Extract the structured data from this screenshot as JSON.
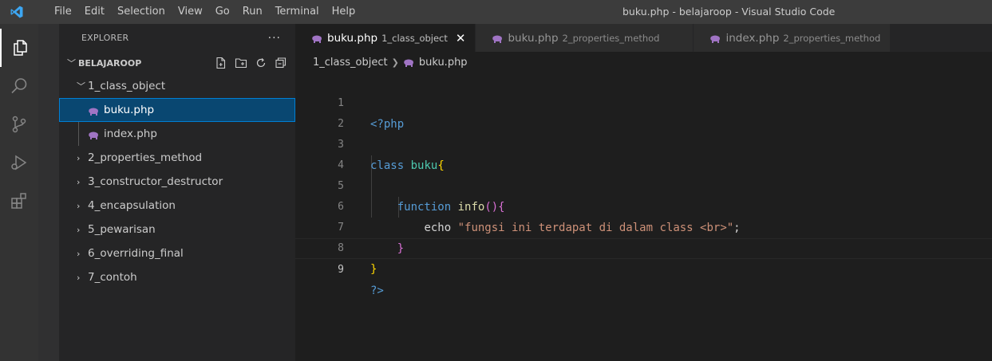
{
  "window": {
    "title": "buku.php - belajaroop - Visual Studio Code"
  },
  "menu": [
    "File",
    "Edit",
    "Selection",
    "View",
    "Go",
    "Run",
    "Terminal",
    "Help"
  ],
  "activity_bar": [
    "files-icon",
    "search-icon",
    "source-control-icon",
    "run-debug-icon",
    "extensions-icon"
  ],
  "sidebar": {
    "header": "EXPLORER",
    "more": "···",
    "section": "BELAJAROOP",
    "tree": [
      {
        "label": "1_class_object",
        "type": "folder",
        "expanded": true
      },
      {
        "label": "buku.php",
        "type": "file",
        "selected": true
      },
      {
        "label": "index.php",
        "type": "file"
      },
      {
        "label": "2_properties_method",
        "type": "folder"
      },
      {
        "label": "3_constructor_destructor",
        "type": "folder"
      },
      {
        "label": "4_encapsulation",
        "type": "folder"
      },
      {
        "label": "5_pewarisan",
        "type": "folder"
      },
      {
        "label": "6_overriding_final",
        "type": "folder"
      },
      {
        "label": "7_contoh",
        "type": "folder"
      }
    ]
  },
  "tabs": [
    {
      "name": "buku.php",
      "desc": "1_class_object",
      "active": true,
      "close": "✕"
    },
    {
      "name": "buku.php",
      "desc": "2_properties_method",
      "active": false
    },
    {
      "name": "index.php",
      "desc": "2_properties_method",
      "active": false
    }
  ],
  "breadcrumb": {
    "folder": "1_class_object",
    "file": "buku.php"
  },
  "editor": {
    "line_numbers": [
      "1",
      "2",
      "3",
      "4",
      "5",
      "6",
      "7",
      "8",
      "9"
    ],
    "lines": [
      "<?php",
      "",
      "class buku{",
      "",
      "    function info(){",
      "        echo \"fungsi ini terdapat di dalam class <br>\";",
      "    }",
      "}",
      "?>"
    ],
    "current_line": 9
  },
  "colors": {
    "titlebar": "#3c3c3c",
    "activitybar": "#333333",
    "sidebar": "#252526",
    "editor": "#1e1e1e",
    "selection": "#094771",
    "php_elephant": "#a074c4"
  }
}
